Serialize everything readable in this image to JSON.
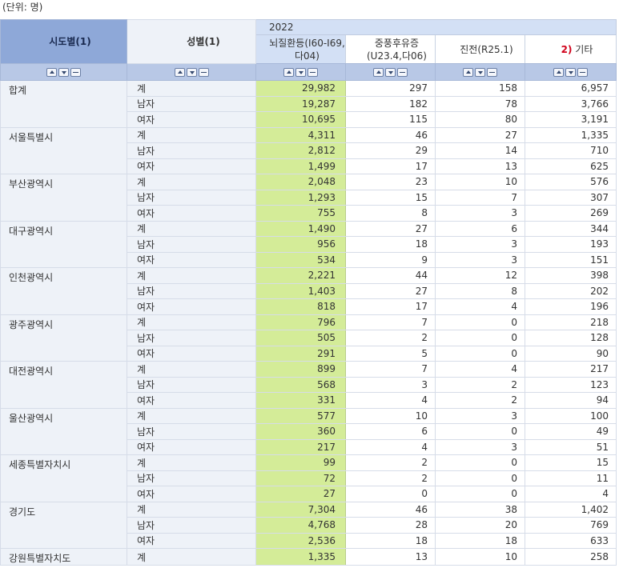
{
  "unit_label": "(단위: 명)",
  "header": {
    "region_col": "시도별(1)",
    "sex_col": "성별(1)",
    "year": "2022",
    "value_cols": [
      {
        "label": "뇌질환등(I60-I69,다04)",
        "prefix": ""
      },
      {
        "label": "중풍후유증(U23.4,다06)",
        "prefix": ""
      },
      {
        "label": "진전(R25.1)",
        "prefix": ""
      },
      {
        "label": "기타",
        "prefix": "2)"
      }
    ]
  },
  "sort_buttons": {
    "up": "ascending",
    "down": "descending",
    "minus": "remove"
  },
  "rows": [
    {
      "region": "합계",
      "sex": "계",
      "values": [
        "29,982",
        "297",
        "158",
        "6,957"
      ]
    },
    {
      "region": "",
      "sex": "남자",
      "values": [
        "19,287",
        "182",
        "78",
        "3,766"
      ]
    },
    {
      "region": "",
      "sex": "여자",
      "values": [
        "10,695",
        "115",
        "80",
        "3,191"
      ]
    },
    {
      "region": "서울특별시",
      "sex": "계",
      "values": [
        "4,311",
        "46",
        "27",
        "1,335"
      ]
    },
    {
      "region": "",
      "sex": "남자",
      "values": [
        "2,812",
        "29",
        "14",
        "710"
      ]
    },
    {
      "region": "",
      "sex": "여자",
      "values": [
        "1,499",
        "17",
        "13",
        "625"
      ]
    },
    {
      "region": "부산광역시",
      "sex": "계",
      "values": [
        "2,048",
        "23",
        "10",
        "576"
      ]
    },
    {
      "region": "",
      "sex": "남자",
      "values": [
        "1,293",
        "15",
        "7",
        "307"
      ]
    },
    {
      "region": "",
      "sex": "여자",
      "values": [
        "755",
        "8",
        "3",
        "269"
      ]
    },
    {
      "region": "대구광역시",
      "sex": "계",
      "values": [
        "1,490",
        "27",
        "6",
        "344"
      ]
    },
    {
      "region": "",
      "sex": "남자",
      "values": [
        "956",
        "18",
        "3",
        "193"
      ]
    },
    {
      "region": "",
      "sex": "여자",
      "values": [
        "534",
        "9",
        "3",
        "151"
      ]
    },
    {
      "region": "인천광역시",
      "sex": "계",
      "values": [
        "2,221",
        "44",
        "12",
        "398"
      ]
    },
    {
      "region": "",
      "sex": "남자",
      "values": [
        "1,403",
        "27",
        "8",
        "202"
      ]
    },
    {
      "region": "",
      "sex": "여자",
      "values": [
        "818",
        "17",
        "4",
        "196"
      ]
    },
    {
      "region": "광주광역시",
      "sex": "계",
      "values": [
        "796",
        "7",
        "0",
        "218"
      ]
    },
    {
      "region": "",
      "sex": "남자",
      "values": [
        "505",
        "2",
        "0",
        "128"
      ]
    },
    {
      "region": "",
      "sex": "여자",
      "values": [
        "291",
        "5",
        "0",
        "90"
      ]
    },
    {
      "region": "대전광역시",
      "sex": "계",
      "values": [
        "899",
        "7",
        "4",
        "217"
      ]
    },
    {
      "region": "",
      "sex": "남자",
      "values": [
        "568",
        "3",
        "2",
        "123"
      ]
    },
    {
      "region": "",
      "sex": "여자",
      "values": [
        "331",
        "4",
        "2",
        "94"
      ]
    },
    {
      "region": "울산광역시",
      "sex": "계",
      "values": [
        "577",
        "10",
        "3",
        "100"
      ]
    },
    {
      "region": "",
      "sex": "남자",
      "values": [
        "360",
        "6",
        "0",
        "49"
      ]
    },
    {
      "region": "",
      "sex": "여자",
      "values": [
        "217",
        "4",
        "3",
        "51"
      ]
    },
    {
      "region": "세종특별자치시",
      "sex": "계",
      "values": [
        "99",
        "2",
        "0",
        "15"
      ]
    },
    {
      "region": "",
      "sex": "남자",
      "values": [
        "72",
        "2",
        "0",
        "11"
      ]
    },
    {
      "region": "",
      "sex": "여자",
      "values": [
        "27",
        "0",
        "0",
        "4"
      ]
    },
    {
      "region": "경기도",
      "sex": "계",
      "values": [
        "7,304",
        "46",
        "38",
        "1,402"
      ]
    },
    {
      "region": "",
      "sex": "남자",
      "values": [
        "4,768",
        "28",
        "20",
        "769"
      ]
    },
    {
      "region": "",
      "sex": "여자",
      "values": [
        "2,536",
        "18",
        "18",
        "633"
      ]
    },
    {
      "region": "강원특별자치도",
      "sex": "계",
      "values": [
        "1,335",
        "13",
        "10",
        "258"
      ]
    }
  ],
  "colors": {
    "header_bg": "#8ea8d8",
    "subheader_bg": "#d3e0f5",
    "highlight_col": "#d4ec98",
    "label_bg": "#eef2f8",
    "accent_red": "#d0021b"
  }
}
